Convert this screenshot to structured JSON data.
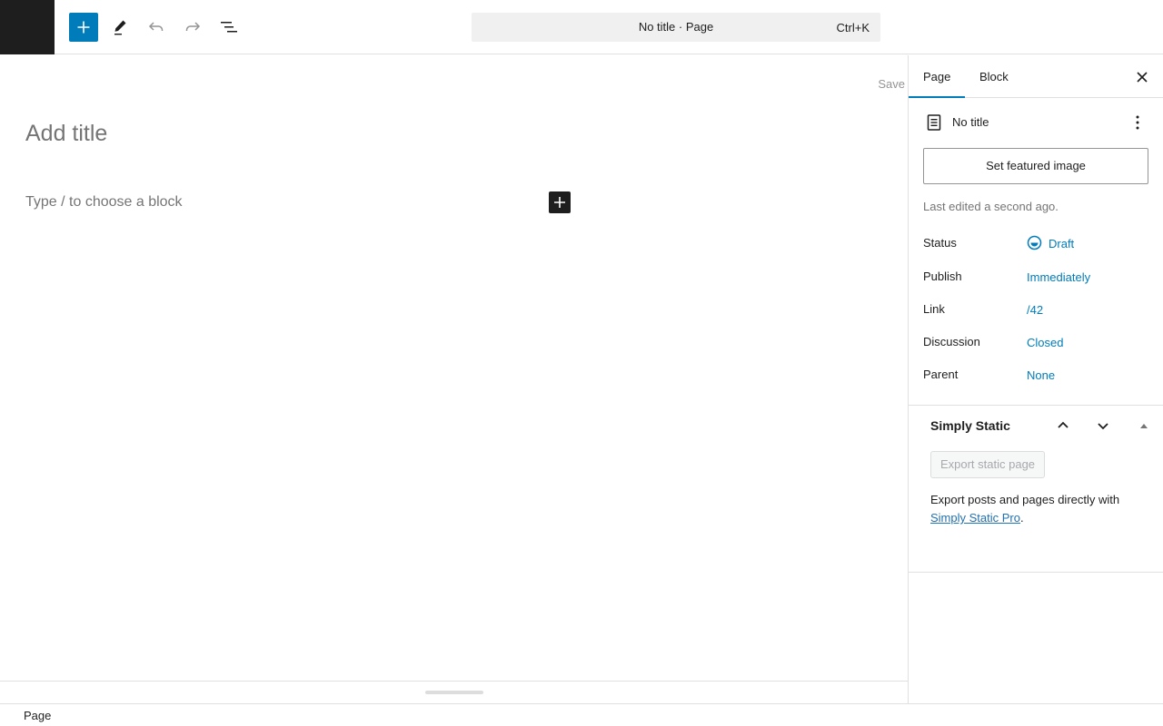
{
  "header": {
    "doc_title": "No title · Page",
    "shortcut": "Ctrl+K"
  },
  "editor": {
    "save_label": "Save",
    "title_placeholder": "Add title",
    "block_placeholder": "Type / to choose a block"
  },
  "sidebar": {
    "tabs": [
      {
        "label": "Page",
        "active": true
      },
      {
        "label": "Block",
        "active": false
      }
    ],
    "doc_name": "No title",
    "featured_image_label": "Set featured image",
    "last_edited": "Last edited a second ago.",
    "meta": [
      {
        "label": "Status",
        "value": "Draft"
      },
      {
        "label": "Publish",
        "value": "Immediately"
      },
      {
        "label": "Link",
        "value": "/42"
      },
      {
        "label": "Discussion",
        "value": "Closed"
      },
      {
        "label": "Parent",
        "value": "None"
      }
    ],
    "simply_static": {
      "title": "Simply Static",
      "export_label": "Export static page",
      "desc_prefix": "Export posts and pages directly with ",
      "link_text": "Simply Static Pro",
      "desc_suffix": "."
    }
  },
  "footer": {
    "breadcrumb": "Page"
  },
  "colors": {
    "accent": "#007cba",
    "dark": "#1e1e1e"
  },
  "icons": [
    "plus-icon",
    "pencil-icon",
    "undo-icon",
    "redo-icon",
    "list-view-icon",
    "close-icon",
    "page-icon",
    "more-vertical-icon",
    "draft-status-icon",
    "chevron-up-icon",
    "chevron-down-icon",
    "caret-up-icon"
  ]
}
